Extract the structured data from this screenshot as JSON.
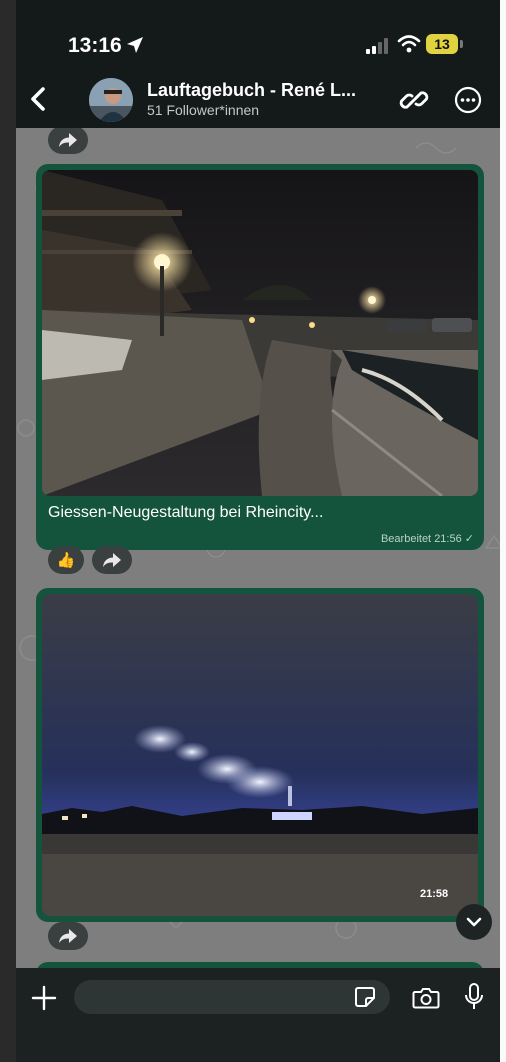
{
  "status_bar": {
    "time": "13:16",
    "battery": "13"
  },
  "header": {
    "channel_name": "Lauftagebuch - René L...",
    "followers": "51 Follower*innen"
  },
  "messages": [
    {
      "caption": "Giessen-Neugestaltung bei Rheincity...",
      "edited_label": "Bearbeitet",
      "time": "21:56",
      "check": "✓",
      "reaction": "👍"
    },
    {
      "time": "21:58"
    }
  ],
  "input": {
    "placeholder": ""
  },
  "colors": {
    "bubble": "#14543d",
    "chat_background": "#7e7e7e",
    "header": "#141a1a",
    "battery": "#e0d240"
  }
}
